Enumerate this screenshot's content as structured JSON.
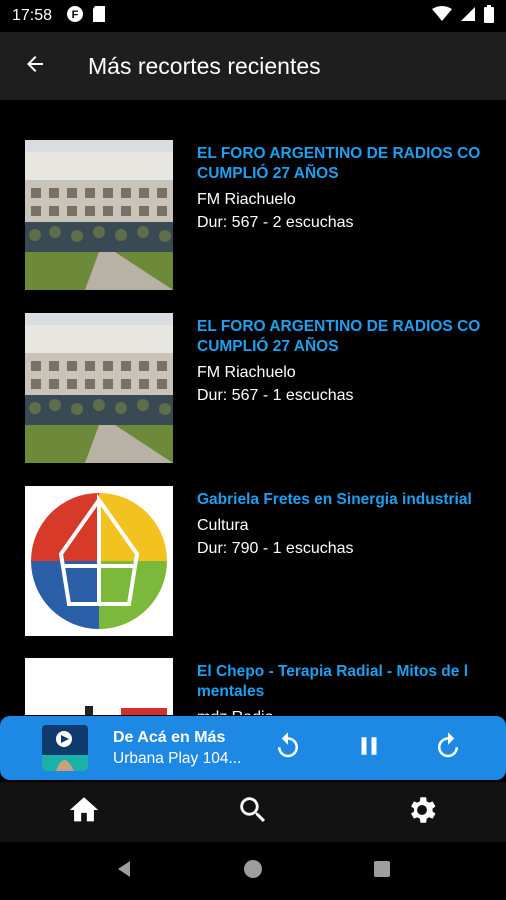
{
  "status_bar": {
    "time": "17:58",
    "icons": [
      "app-notification-icon",
      "sd-card-icon",
      "wifi-icon",
      "signal-icon",
      "battery-icon"
    ]
  },
  "app_bar": {
    "back_icon": "arrow-left-icon",
    "title": "Más recortes recientes"
  },
  "items": [
    {
      "title": "EL FORO ARGENTINO DE RADIOS CO CUMPLIÓ 27 AÑOS",
      "station": "FM Riachuelo",
      "duration": "Dur: 567 - 2 escuchas",
      "thumb": "group-photo"
    },
    {
      "title": "EL FORO ARGENTINO DE RADIOS CO CUMPLIÓ 27 AÑOS",
      "station": "FM Riachuelo",
      "duration": "Dur: 567 - 1 escuchas",
      "thumb": "group-photo"
    },
    {
      "title": "Gabriela Fretes en Sinergia industrial",
      "station": "Cultura",
      "duration": "Dur: 790 - 1 escuchas",
      "thumb": "colorful-logo"
    },
    {
      "title": "El Chepo - Terapia Radial - Mitos de l mentales",
      "station": "mdz Radio",
      "duration": "",
      "thumb": "white-logo"
    }
  ],
  "player": {
    "title": "De Acá en Más",
    "subtitle": "Urbana Play 104...",
    "colors": {
      "background": "#1e88e5"
    },
    "icons": [
      "replay-icon",
      "pause-icon",
      "forward-icon"
    ]
  },
  "bottom_nav": {
    "icons": [
      "home-icon",
      "search-icon",
      "settings-icon"
    ]
  },
  "system_nav": {
    "icons": [
      "back-triangle-icon",
      "home-circle-icon",
      "recents-square-icon"
    ]
  },
  "colors": {
    "accent": "#1ea0f0",
    "app_bar": "#1e1e1e",
    "background": "#000000"
  }
}
